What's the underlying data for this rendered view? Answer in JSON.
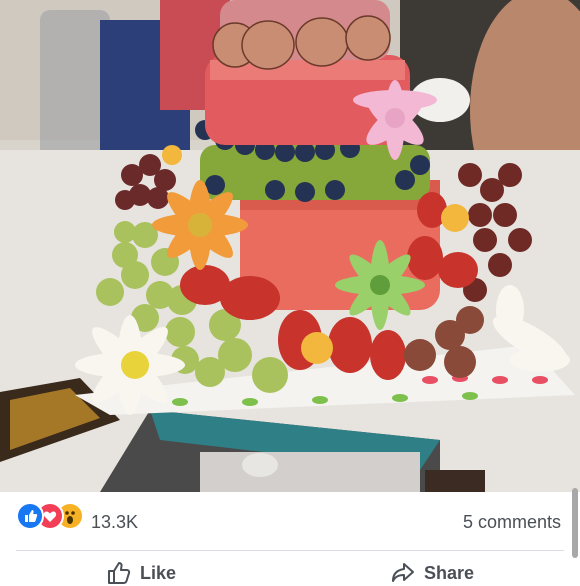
{
  "post": {
    "image_alt": "Watermelon fruit cake decorated with grapes, strawberries, kiwi, blueberries and flowers",
    "reactions": {
      "icons": [
        "like-icon",
        "love-icon",
        "wow-icon"
      ],
      "colors": {
        "like": "#1877f2",
        "love": "#f33e58",
        "wow": "#f7b125"
      },
      "count": "13.3K"
    },
    "comments_label": "5 comments",
    "actions": {
      "like_label": "Like",
      "share_label": "Share"
    }
  }
}
